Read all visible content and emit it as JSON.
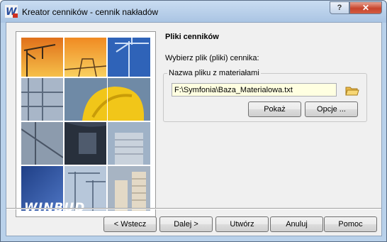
{
  "window": {
    "title": "Kreator cenników - cennik nakładów",
    "help_label": "?",
    "close_label": "✕"
  },
  "panel": {
    "heading": "Pliki cenników",
    "instruction": "Wybierz plik (pliki) cennika:"
  },
  "file_group": {
    "legend": "Nazwa pliku z materiałami",
    "path_value": "F:\\Symfonia\\Baza_Materialowa.txt",
    "show_label": "Pokaż",
    "options_label": "Opcje ..."
  },
  "branding": {
    "logo_text": "WINBUD"
  },
  "footer": {
    "back_label": "< Wstecz",
    "next_label": "Dalej >",
    "create_label": "Utwórz",
    "cancel_label": "Anuluj",
    "help_label": "Pomoc"
  },
  "colors": {
    "title_bar": "#b9d1ea",
    "close_button": "#c7452d",
    "input_background": "#ffffe1",
    "logo_tile": "#2b4f9e"
  }
}
